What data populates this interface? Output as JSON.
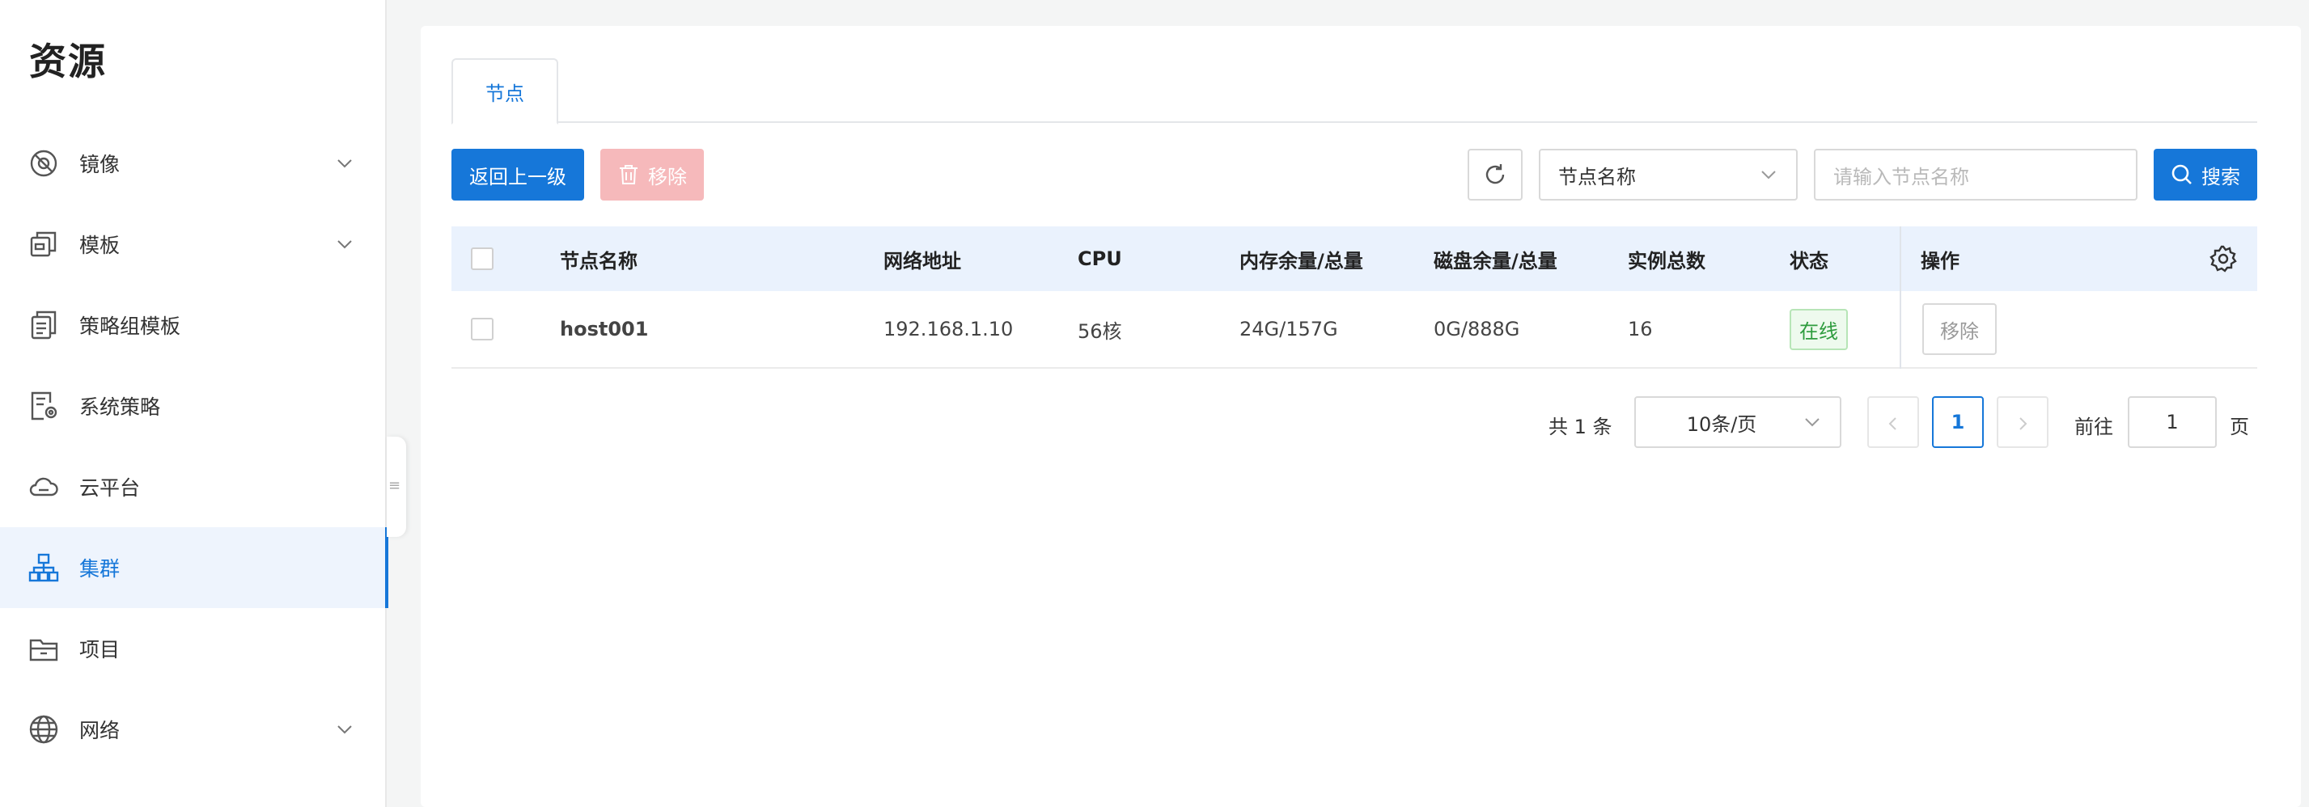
{
  "sidebar": {
    "title": "资源",
    "items": [
      {
        "label": "镜像",
        "icon": "image-disc-icon",
        "has_chevron": true
      },
      {
        "label": "模板",
        "icon": "template-icon",
        "has_chevron": true
      },
      {
        "label": "策略组模板",
        "icon": "policy-group-template-icon",
        "has_chevron": false
      },
      {
        "label": "系统策略",
        "icon": "system-policy-icon",
        "has_chevron": false
      },
      {
        "label": "云平台",
        "icon": "cloud-icon",
        "has_chevron": false
      },
      {
        "label": "集群",
        "icon": "cluster-icon",
        "has_chevron": false,
        "active": true
      },
      {
        "label": "项目",
        "icon": "folder-icon",
        "has_chevron": false
      },
      {
        "label": "网络",
        "icon": "globe-icon",
        "has_chevron": true
      }
    ]
  },
  "tabs": [
    {
      "label": "节点",
      "active": true
    }
  ],
  "toolbar": {
    "back_label": "返回上一级",
    "remove_label": "移除",
    "filter_select_value": "节点名称",
    "search_placeholder": "请输入节点名称",
    "search_label": "搜索"
  },
  "table": {
    "columns": [
      "节点名称",
      "网络地址",
      "CPU",
      "内存余量/总量",
      "磁盘余量/总量",
      "实例总数",
      "状态",
      "操作"
    ],
    "rows": [
      {
        "name": "host001",
        "address": "192.168.1.10",
        "cpu": "56核",
        "memory": "24G/157G",
        "disk": "0G/888G",
        "instances": "16",
        "status": "在线",
        "action": "移除"
      }
    ]
  },
  "pagination": {
    "total_text": "共 1 条",
    "page_size": "10条/页",
    "current_page": "1",
    "goto_label": "前往",
    "goto_value": "1",
    "page_suffix": "页"
  },
  "colors": {
    "primary": "#1677d9",
    "danger_disabled": "#f6b9bb",
    "header_bg": "#eaf2fd",
    "online_green": "#2e9c3e"
  }
}
